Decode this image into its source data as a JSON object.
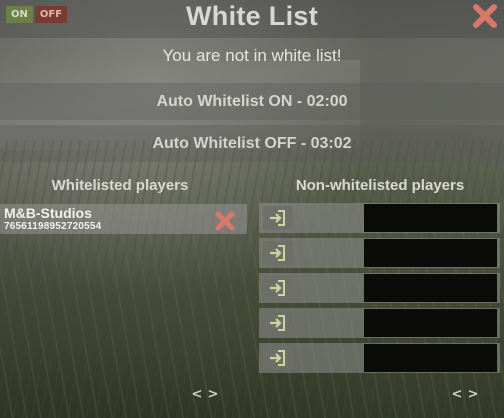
{
  "header": {
    "on_label": "ON",
    "off_label": "OFF",
    "title": "White List"
  },
  "message": "You are not in white list!",
  "schedule": {
    "on_label": "Auto Whitelist ON - 02:00",
    "off_label": "Auto Whitelist OFF - 03:02"
  },
  "whitelisted": {
    "heading": "Whitelisted players",
    "players": [
      {
        "name": "M&B-Studios",
        "id": "76561198952720554"
      }
    ],
    "prev_label": "<",
    "next_label": ">"
  },
  "non_whitelisted": {
    "heading": "Non-whitelisted players",
    "row_count": 5,
    "prev_label": "<",
    "next_label": ">"
  },
  "colors": {
    "on": "#6c7f46",
    "off": "#7a3b30",
    "remove_x": "#d9776a",
    "close_x": "#d9776a",
    "add_arrow": "#c9d69a"
  },
  "icons": {
    "close": "close-icon",
    "remove": "remove-icon",
    "add": "add-to-whitelist-icon"
  }
}
